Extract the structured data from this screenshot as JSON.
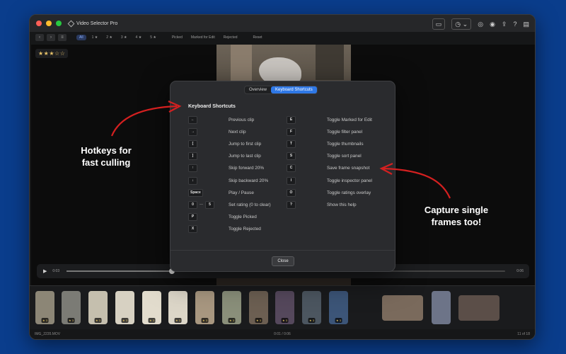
{
  "app": {
    "title": "Video Selector Pro"
  },
  "toolbar": {
    "filters": [
      "All",
      "1 ★",
      "2 ★",
      "3 ★",
      "4 ★",
      "5 ★"
    ],
    "status_filters": [
      "Picked",
      "Marked for Edit",
      "Rejected"
    ],
    "reset_label": "Reset"
  },
  "viewer": {
    "rating": "★★★☆☆"
  },
  "playback": {
    "current_time": "0:03",
    "end_time": "0:06",
    "progress": 0.24
  },
  "filmstrip": {
    "thumbs": [
      {
        "badge": "★ 3",
        "color": "#8c8676"
      },
      {
        "badge": "★ 3",
        "color": "#7b7b75"
      },
      {
        "badge": "★ 3",
        "color": "#c5bfae"
      },
      {
        "badge": "★ 3",
        "color": "#d7d1c2"
      },
      {
        "badge": "★ 3",
        "color": "#e2dccd"
      },
      {
        "badge": "★ 3",
        "color": "#dcd6c8"
      },
      {
        "badge": "★ 3",
        "color": "#a89780"
      },
      {
        "badge": "★ 3",
        "color": "#8a8f7a"
      },
      {
        "badge": "★ 3",
        "color": "#6c5f52"
      },
      {
        "badge": "★ 3",
        "color": "#55485c"
      },
      {
        "badge": "★ 3",
        "color": "#4c5660"
      },
      {
        "badge": "★ 3",
        "color": "#3c5578"
      },
      {
        "badge": "",
        "color": "#7a6a5c"
      },
      {
        "badge": "",
        "color": "#6d7488"
      },
      {
        "badge": "",
        "color": "#5b4e48"
      }
    ]
  },
  "status": {
    "filename": "IMG_2235.MOV",
    "time": "0:01 / 0:06",
    "position": "11 of 18"
  },
  "modal": {
    "tabs": [
      "Overview",
      "Keyboard Shortcuts"
    ],
    "heading": "Keyboard Shortcuts",
    "left": [
      {
        "keys": [
          "←"
        ],
        "label": "Previous clip"
      },
      {
        "keys": [
          "→"
        ],
        "label": "Next clip"
      },
      {
        "keys": [
          "["
        ],
        "label": "Jump to first clip"
      },
      {
        "keys": [
          "]"
        ],
        "label": "Jump to last clip"
      },
      {
        "keys": [
          "↑"
        ],
        "label": "Skip forward 20%"
      },
      {
        "keys": [
          "↓"
        ],
        "label": "Skip backward 20%"
      },
      {
        "keys": [
          "Space"
        ],
        "label": "Play / Pause"
      },
      {
        "keys": [
          "0",
          "5"
        ],
        "sep": "—",
        "label": "Set rating (0 to clear)"
      },
      {
        "keys": [
          "P"
        ],
        "label": "Toggle Picked"
      },
      {
        "keys": [
          "X"
        ],
        "label": "Toggle Rejected"
      }
    ],
    "right": [
      {
        "keys": [
          "E"
        ],
        "label": "Toggle Marked for Edit"
      },
      {
        "keys": [
          "F"
        ],
        "label": "Toggle filter panel"
      },
      {
        "keys": [
          "T"
        ],
        "label": "Toggle thumbnails"
      },
      {
        "keys": [
          "S"
        ],
        "label": "Toggle sort panel"
      },
      {
        "keys": [
          "C"
        ],
        "label": "Save frame snapshot"
      },
      {
        "keys": [
          "I"
        ],
        "label": "Toggle inspector panel"
      },
      {
        "keys": [
          "O"
        ],
        "label": "Toggle ratings overlay"
      },
      {
        "keys": [
          "?"
        ],
        "label": "Show this help"
      }
    ],
    "close_label": "Close"
  },
  "callouts": {
    "left": [
      "Hotkeys for",
      "fast culling"
    ],
    "right": [
      "Capture single",
      "frames too!"
    ]
  },
  "colors": {
    "background": "#0a3d8c",
    "accent": "#2f78e6",
    "arrow": "#d42020"
  }
}
